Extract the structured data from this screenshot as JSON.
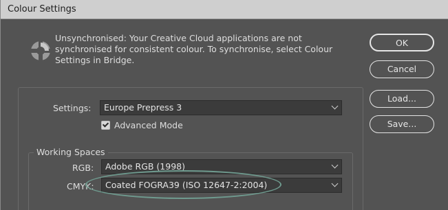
{
  "window": {
    "title": "Colour Settings"
  },
  "sync": {
    "icon": "colour-sync-icon",
    "message": "Unsynchronised: Your Creative Cloud applications are not synchronised for consistent colour. To synchronise, select Colour Settings in Bridge."
  },
  "buttons": {
    "ok": "OK",
    "cancel": "Cancel",
    "load": "Load...",
    "save": "Save..."
  },
  "settings": {
    "label": "Settings:",
    "value": "Europe Prepress 3"
  },
  "advanced_mode": {
    "label": "Advanced Mode",
    "checked": true
  },
  "working_spaces": {
    "legend": "Working Spaces",
    "rgb_label": "RGB:",
    "rgb_value": "Adobe RGB (1998)",
    "cmyk_label": "CMYK:",
    "cmyk_value": "Coated FOGRA39 (ISO 12647-2:2004)"
  },
  "colors": {
    "background": "#535353",
    "highlight": "#6f9b8f"
  }
}
